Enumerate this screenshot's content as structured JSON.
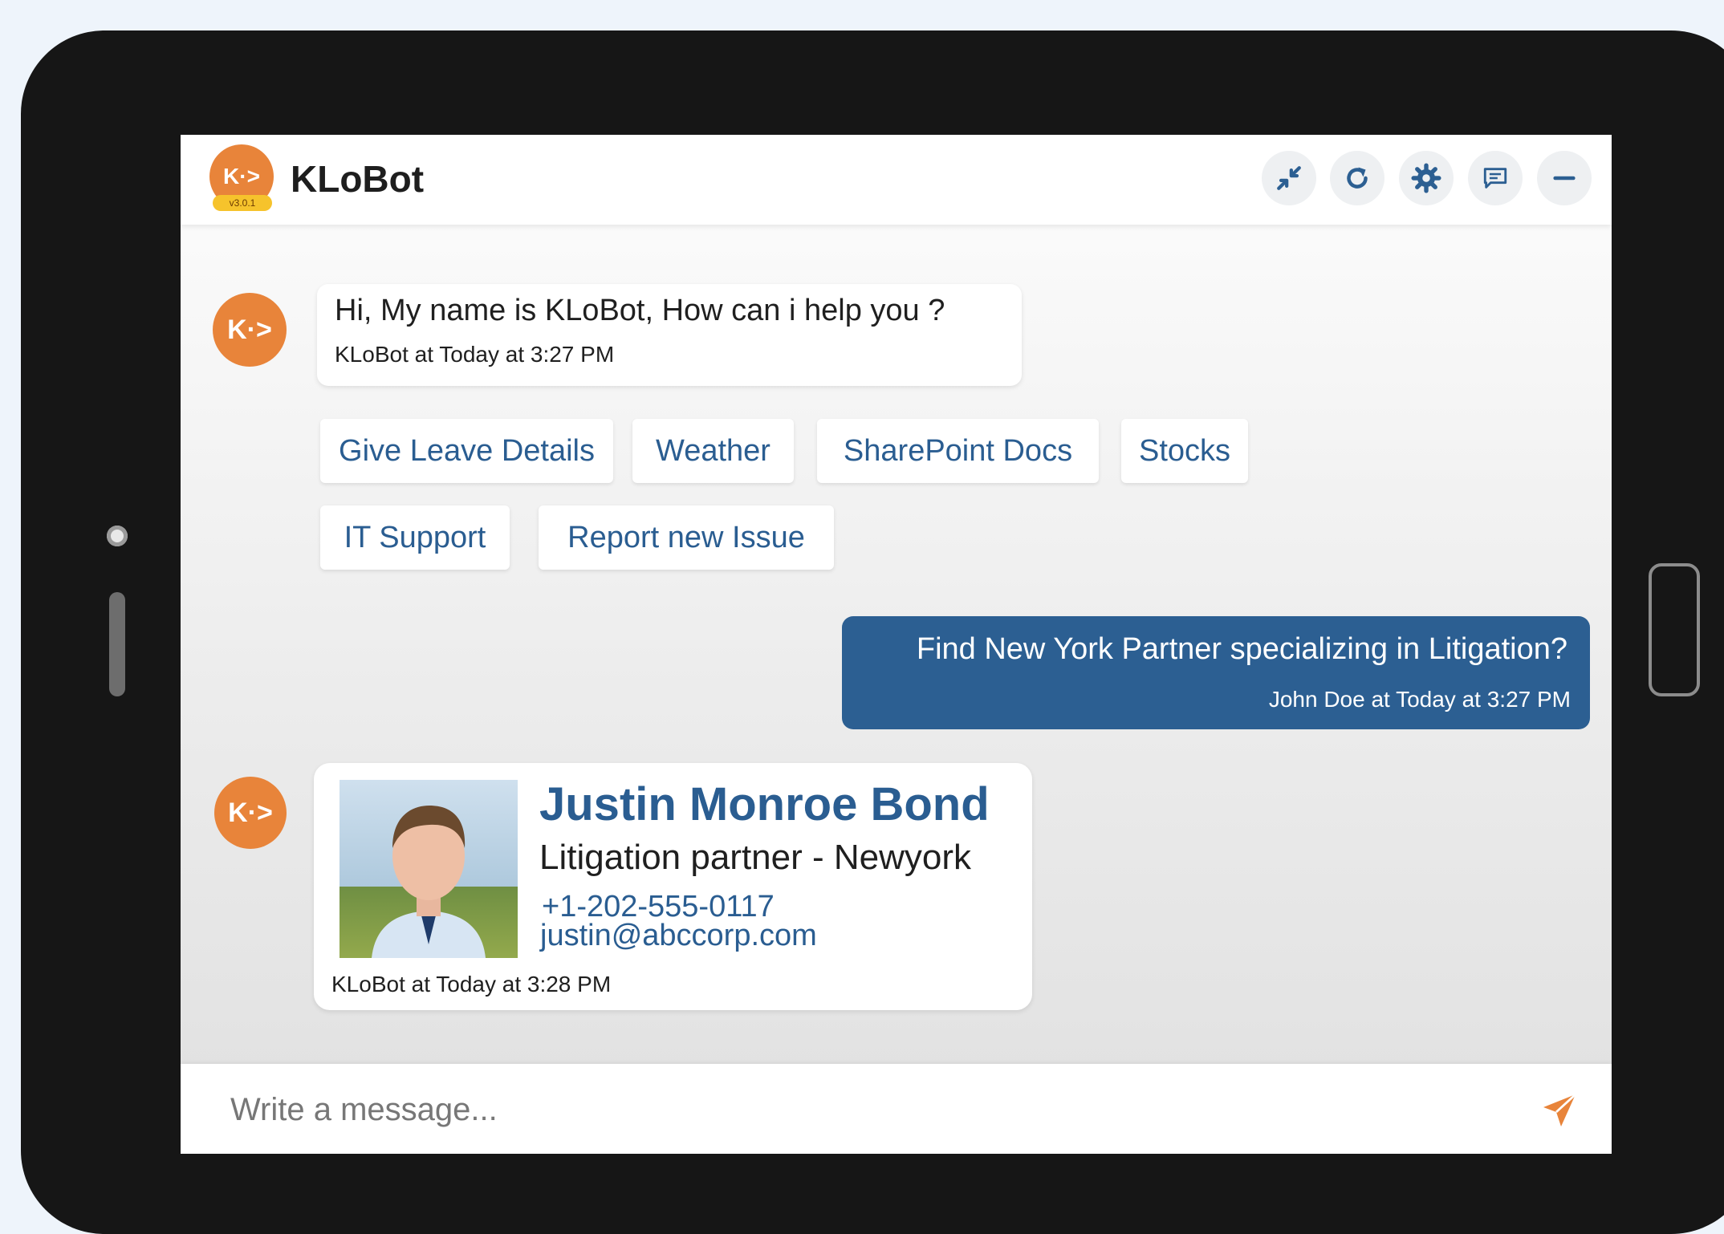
{
  "app": {
    "title": "KLoBot",
    "version": "v3.0.1",
    "logo_text": "K·>"
  },
  "header": {
    "icons": [
      "shrink-icon",
      "refresh-icon",
      "gear-icon",
      "chat-icon",
      "minimize-icon"
    ]
  },
  "conversation": {
    "greeting": {
      "text": "Hi, My name is KLoBot, How can i help you ?",
      "meta": "KLoBot at Today at 3:27 PM"
    },
    "quick_replies": [
      "Give Leave Details",
      "Weather",
      "SharePoint Docs",
      "Stocks",
      "IT Support",
      "Report new Issue"
    ],
    "user_message": {
      "text": "Find New York Partner specializing in Litigation?",
      "meta": "John Doe at Today at 3:27 PM"
    },
    "contact_card": {
      "name": "Justin Monroe Bond",
      "title": "Litigation partner - Newyork",
      "phone": "+1-202-555-0117",
      "email": "justin@abccorp.com",
      "meta": "KLoBot at Today at 3:28 PM"
    }
  },
  "composer": {
    "placeholder": "Write a message..."
  },
  "colors": {
    "accent": "#e8843a",
    "brand_blue": "#2c5f92",
    "link_blue": "#2a5d91"
  }
}
